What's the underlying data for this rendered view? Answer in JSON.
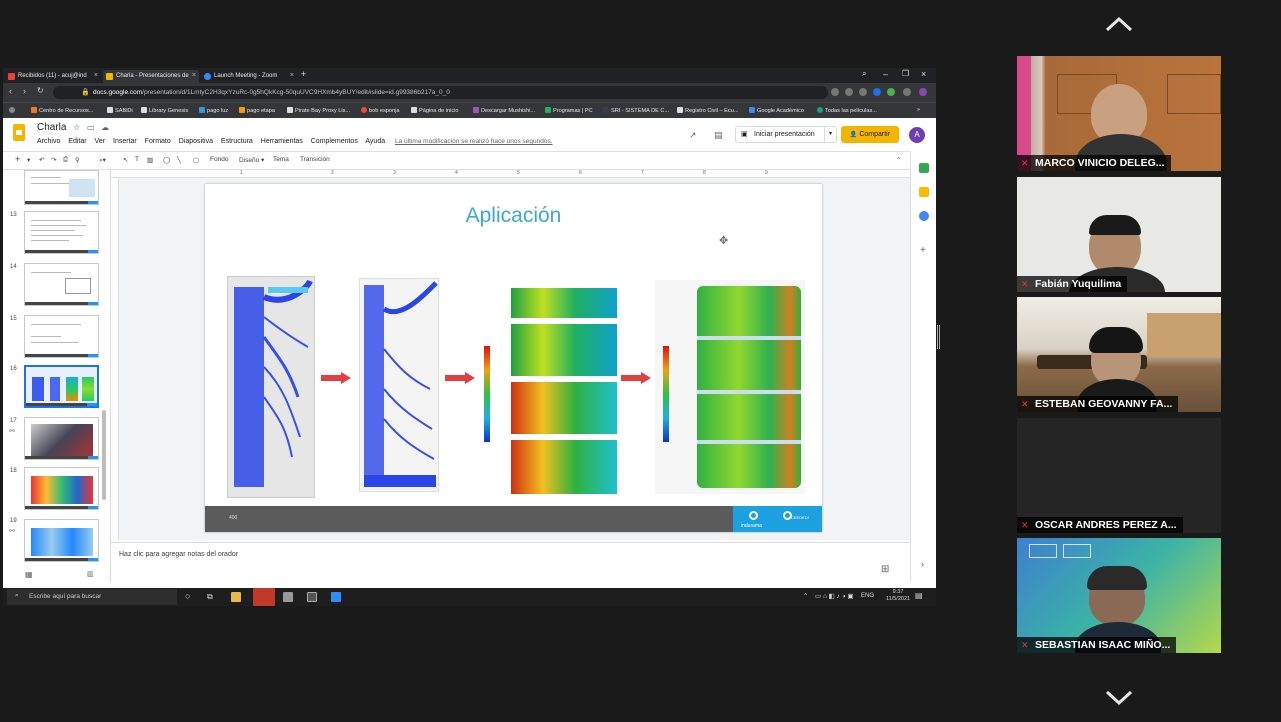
{
  "browser": {
    "tabs": [
      {
        "label": "Recibidos (11) - acuj@ind",
        "active": false
      },
      {
        "label": "Charla - Presentaciones de",
        "active": true
      },
      {
        "label": "Launch Meeting - Zoom",
        "active": false
      }
    ],
    "url_host": "docs.google.com",
    "url_path": "/presentation/d/1LmtyC2H3qxYzuRc-0g5hQkKcg-50quUVC9HXmb4yBUY/edit#slide=id.g99386b217a_0_0",
    "bookmarks": [
      "Centro de Recursos...",
      "SABiDi",
      "Library Genesis",
      "pago luz",
      "pago etapa",
      "Pirate Bay Proxy Lis...",
      "bob esponja",
      "Página de inicio",
      "Descargar Mushishi...",
      "Programas | PC",
      "SRI - SISTEMA DE C...",
      "Registro Civil – Ecu...",
      "Google Académico",
      "Todas las películas..."
    ]
  },
  "slides": {
    "doc_title": "Charla",
    "menu": [
      "Archivo",
      "Editar",
      "Ver",
      "Insertar",
      "Formato",
      "Diapositiva",
      "Estructura",
      "Herramientas",
      "Complementos",
      "Ayuda"
    ],
    "last_edit": "La última modificación se realizó hace unos segundos.",
    "present_label": "Iniciar presentación",
    "share_label": "Compartir",
    "avatar_letter": "A",
    "toolbar": {
      "fondo": "Fondo",
      "diseno": "Diseño ▾",
      "tema": "Tema",
      "transicion": "Transición"
    },
    "thumb_numbers": [
      "13",
      "14",
      "15",
      "16",
      "17",
      "18",
      "19"
    ],
    "slide_title": "Aplicación",
    "slide_number": "400",
    "brand_left": "indurama",
    "brand_right": "CEEDEDI",
    "notes_placeholder": "Haz clic para agregar notas del orador",
    "ruler_numbers": [
      "1",
      "2",
      "3",
      "4",
      "5",
      "6",
      "7",
      "8",
      "9"
    ]
  },
  "taskbar": {
    "search_placeholder": "Escribe aquí para buscar",
    "lang": "ENG",
    "time": "9:37",
    "date": "11/5/2021"
  },
  "participants": [
    {
      "name": "MARCO VINICIO DELEG..."
    },
    {
      "name": "Fabián Yuquilima"
    },
    {
      "name": "ESTEBAN GEOVANNY FA..."
    },
    {
      "name": "OSCAR ANDRES PEREZ A..."
    },
    {
      "name": "SEBASTIAN ISAAC MIÑO..."
    }
  ],
  "colors": {
    "accent_blue": "#3aa8d6",
    "share_yellow": "#f4b400",
    "mic_red": "#e0382e",
    "brand_blue": "#1ba0e0"
  }
}
